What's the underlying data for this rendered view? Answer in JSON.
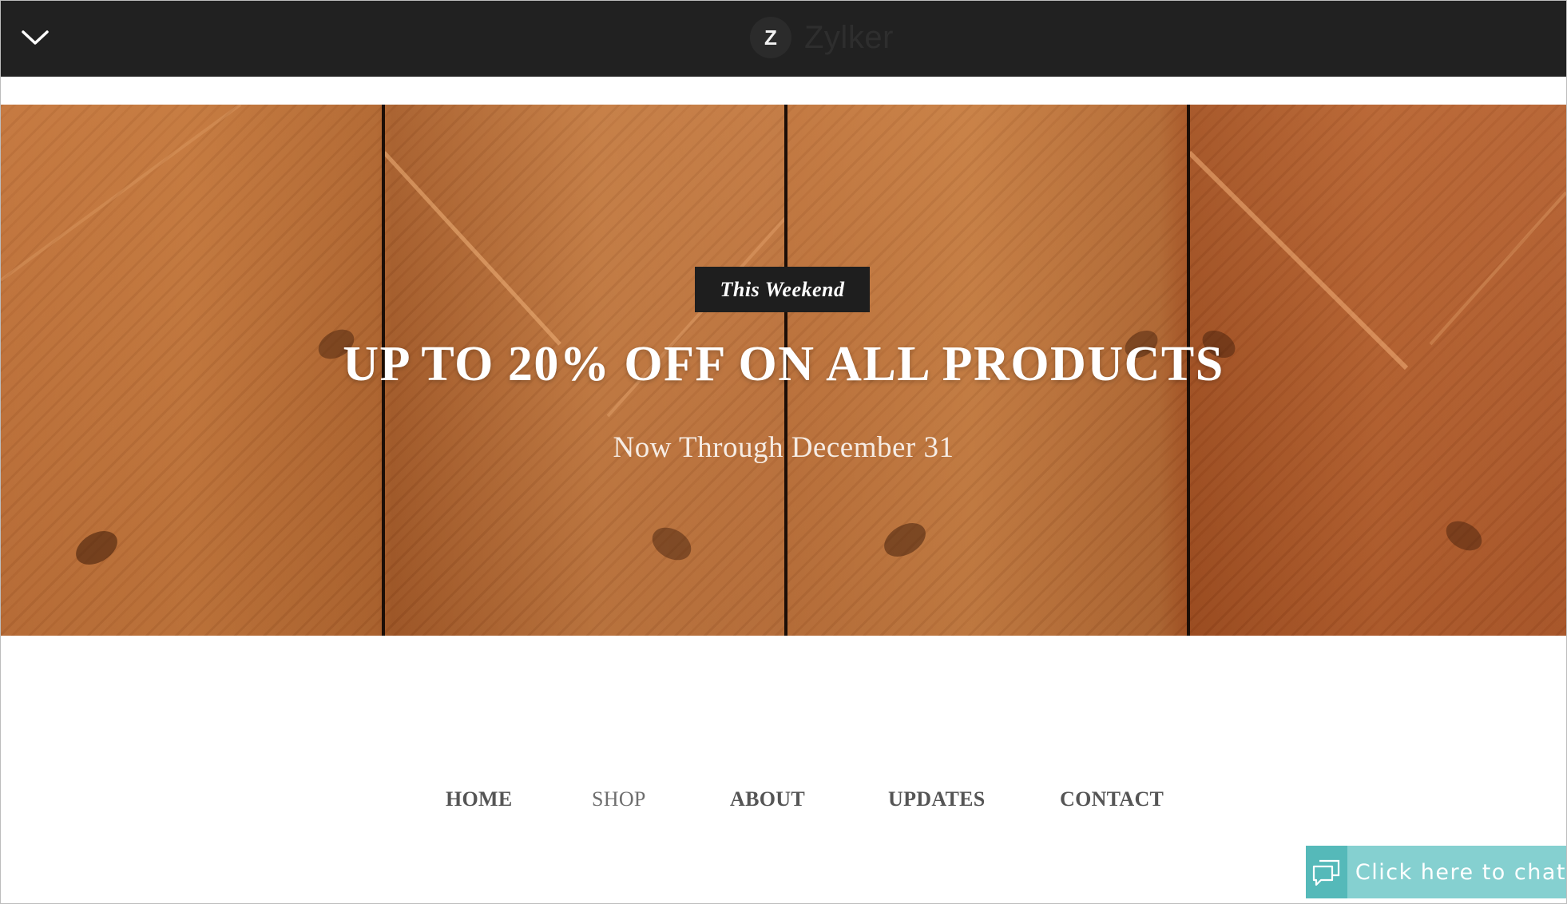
{
  "header": {
    "menu_icon": "chevron-down-icon",
    "brand_initial": "Z",
    "brand_name": "Zylker"
  },
  "hero": {
    "badge": "This Weekend",
    "title": "UP TO 20% OFF ON ALL PRODUCTS",
    "subtitle": "Now Through December 31"
  },
  "nav": {
    "items": [
      {
        "label": "HOME"
      },
      {
        "label": "SHOP"
      },
      {
        "label": "ABOUT"
      },
      {
        "label": "UPDATES"
      },
      {
        "label": "CONTACT"
      }
    ]
  },
  "chat": {
    "icon": "chat-bubbles-icon",
    "label": "Click here to chat"
  },
  "colors": {
    "header_bg": "#212121",
    "chat_bg": "#85d0d0",
    "chat_icon_bg": "#55b9b9",
    "nav_text": "#555555"
  }
}
